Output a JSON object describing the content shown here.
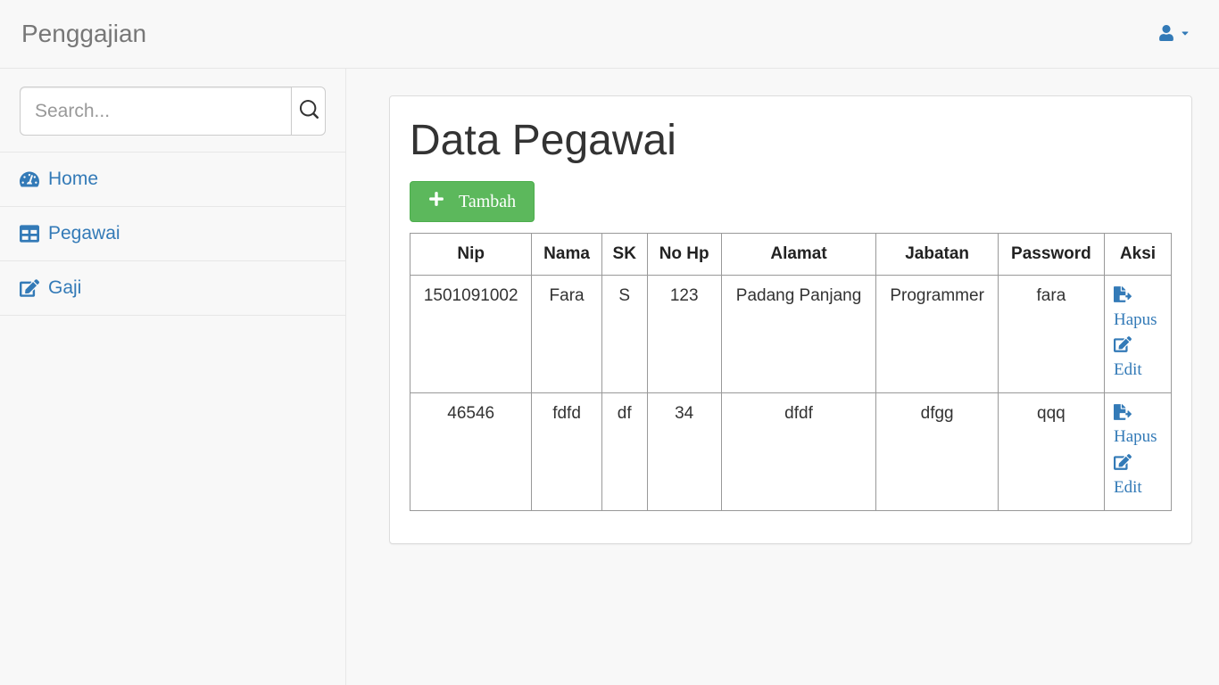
{
  "header": {
    "brand": "Penggajian"
  },
  "search": {
    "placeholder": "Search..."
  },
  "sidebar": {
    "items": [
      {
        "label": "Home"
      },
      {
        "label": "Pegawai"
      },
      {
        "label": "Gaji"
      }
    ]
  },
  "main": {
    "title": "Data Pegawai",
    "add_button": "Tambah",
    "table": {
      "headers": [
        "Nip",
        "Nama",
        "SK",
        "No Hp",
        "Alamat",
        "Jabatan",
        "Password",
        "Aksi"
      ],
      "rows": [
        {
          "nip": "1501091002",
          "nama": "Fara",
          "sk": "S",
          "nohp": "123",
          "alamat": "Padang Panjang",
          "jabatan": "Programmer",
          "password": "fara"
        },
        {
          "nip": "46546",
          "nama": "fdfd",
          "sk": "df",
          "nohp": "34",
          "alamat": "dfdf",
          "jabatan": "dfgg",
          "password": "qqq"
        }
      ],
      "actions": {
        "delete_label": "Hapus",
        "edit_label": "Edit"
      }
    }
  }
}
